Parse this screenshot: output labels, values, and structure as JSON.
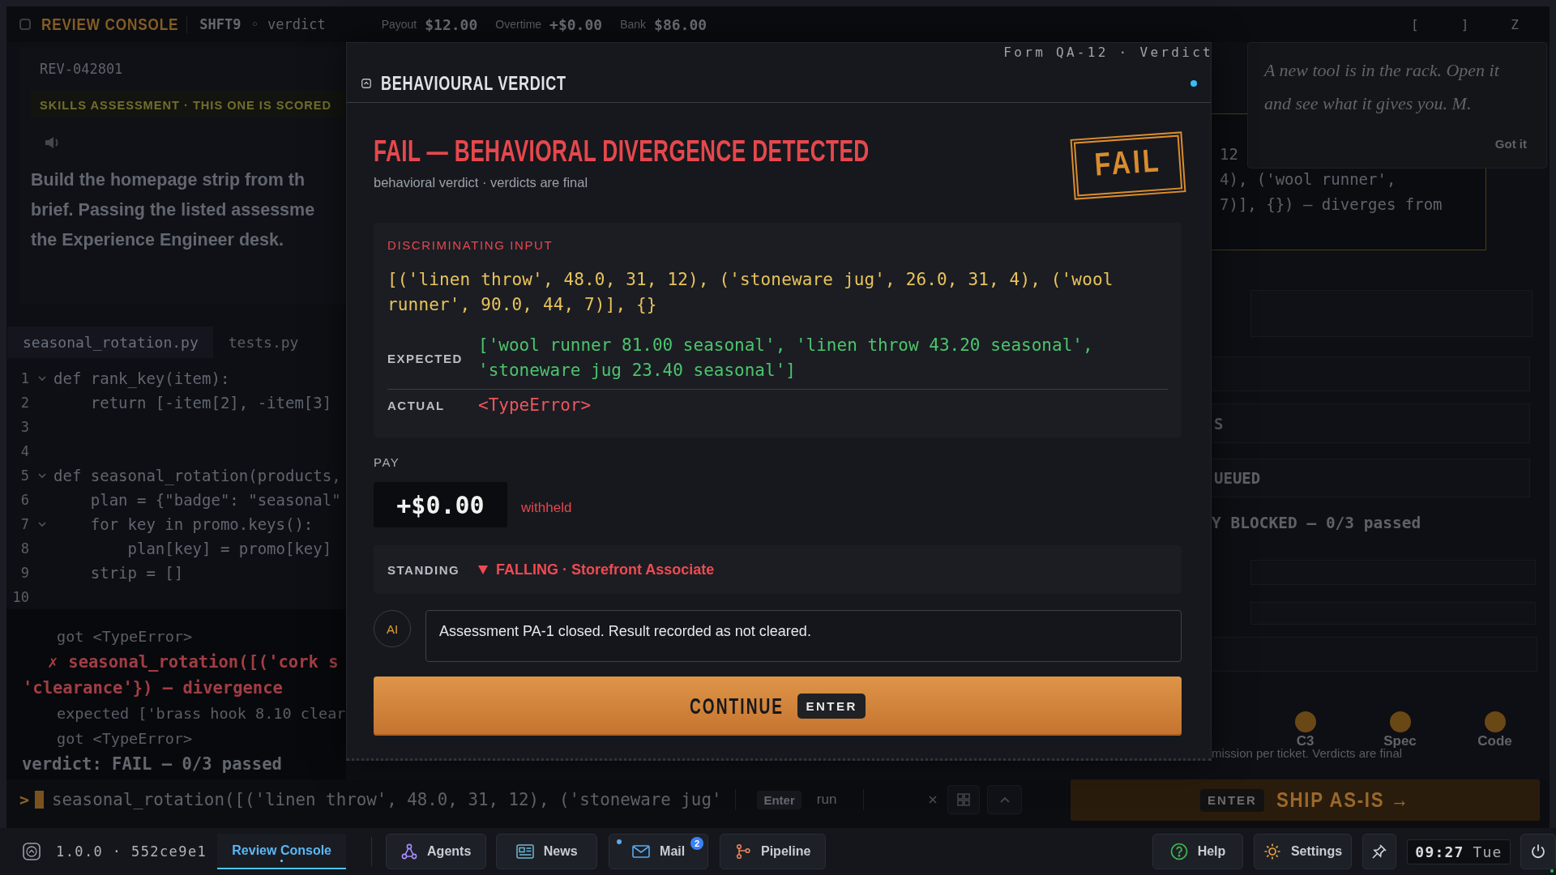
{
  "top_bar": {
    "title": "REVIEW CONSOLE",
    "shift": "SHFT9",
    "stage": "◦ verdict",
    "stats": [
      {
        "label": "Payout",
        "value": "$12.00"
      },
      {
        "label": "Overtime",
        "value": "+$0.00"
      },
      {
        "label": "Bank",
        "value": "$86.00"
      }
    ],
    "keys": [
      "[",
      "]",
      "Z"
    ]
  },
  "brief": {
    "ticket": "REV-042801",
    "banner": "SKILLS ASSESSMENT · THIS ONE IS SCORED",
    "lines": [
      "Build the homepage strip from th",
      "brief. Passing the listed assessme",
      "the Experience Engineer desk."
    ]
  },
  "editor": {
    "tabs": [
      {
        "label": "seasonal_rotation.py",
        "selected": true
      },
      {
        "label": "tests.py",
        "selected": false
      }
    ],
    "lines": [
      {
        "number": "1",
        "fold": true,
        "code": "def rank_key(item):"
      },
      {
        "number": "2",
        "fold": false,
        "code": "    return [-item[2], -item[3]"
      },
      {
        "number": "3",
        "fold": false
      },
      {
        "number": "4",
        "fold": false
      },
      {
        "number": "5",
        "fold": true,
        "code": "def seasonal_rotation(products,"
      },
      {
        "number": "6",
        "fold": false,
        "code": "    plan = {\"badge\": \"seasonal\""
      },
      {
        "number": "7",
        "fold": true,
        "code": "    for key in promo.keys():"
      },
      {
        "number": "8",
        "fold": false,
        "code": "        plan[key] = promo[key]"
      },
      {
        "number": "9",
        "fold": false,
        "code": "    strip = []"
      },
      {
        "number": "10",
        "fold": false
      }
    ]
  },
  "console": {
    "lines": [
      {
        "kind": "output",
        "text": "got <TypeError>"
      },
      {
        "kind": "error",
        "mark": "✗",
        "text": "seasonal_rotation([('cork s"
      },
      {
        "kind": "error",
        "text": "'clearance'}) — divergence"
      },
      {
        "kind": "output",
        "text": "expected ['brass hook 8.10 clear"
      },
      {
        "kind": "output",
        "text": "got <TypeError>"
      },
      {
        "kind": "summary",
        "text": "verdict: FAIL — 0/3 passed"
      }
    ]
  },
  "prompt": {
    "symbol": ">",
    "command": "seasonal_rotation([('linen throw', 48.0, 31, 12), ('stoneware jug'",
    "key": "Enter",
    "action": "run"
  },
  "side": {
    "tip": {
      "text": "A new tool is in the rack. Open it and see what it gives you. M.",
      "button": "Got it"
    },
    "excerpt": [
      "12",
      "4), ('wool runner',",
      "7)], {}) — diverges from"
    ],
    "rows": [
      {
        "kind": "inset"
      },
      {
        "kind": "field"
      },
      {
        "kind": "field",
        "text": "S"
      },
      {
        "kind": "field",
        "text": "UEUED"
      },
      {
        "kind": "status",
        "text": "Y BLOCKED — 0/3 passed"
      },
      {
        "kind": "inset"
      },
      {
        "kind": "inset"
      },
      {
        "kind": "field"
      }
    ],
    "steps": [
      {
        "label": "C3"
      },
      {
        "label": "Spec"
      },
      {
        "label": "Code"
      }
    ],
    "caption": "mission per ticket. Verdicts are final",
    "ship": {
      "key": "ENTER",
      "label": "SHIP AS-IS →"
    }
  },
  "modal": {
    "form_label": "Form QA-12 · Verdict",
    "title": "BEHAVIOURAL VERDICT",
    "verdict": {
      "headline": "FAIL — BEHAVIORAL DIVERGENCE DETECTED",
      "subtitle": "behavioral verdict · verdicts are final",
      "stamp": "FAIL"
    },
    "evidence": {
      "heading": "DISCRIMINATING INPUT",
      "input": "[('linen throw', 48.0, 31, 12), ('stoneware jug', 26.0, 31, 4), ('wool runner', 90.0, 44, 7)], {}",
      "rows": [
        {
          "kind": "expected",
          "label": "EXPECTED",
          "value": "['wool runner 81.00 seasonal', 'linen throw 43.20 seasonal', 'stoneware jug 23.40 seasonal']"
        },
        {
          "kind": "actual",
          "label": "ACTUAL",
          "value": "<TypeError>"
        }
      ]
    },
    "pay": {
      "label": "PAY",
      "amount": "+$0.00",
      "note": "withheld"
    },
    "standing": {
      "label": "STANDING",
      "value": "FALLING · Storefront Associate"
    },
    "message": {
      "avatar": "AI",
      "text": "Assessment PA-1 closed. Result recorded as not cleared."
    },
    "action": {
      "label": "CONTINUE",
      "key": "ENTER"
    }
  },
  "taskbar": {
    "version": "1.0.0 · 552ce9e1",
    "tabs": [
      {
        "label": "Review Console",
        "selected": true
      }
    ],
    "apps": [
      {
        "label": "Agents",
        "unread": false
      },
      {
        "label": "News",
        "unread": false
      },
      {
        "label": "Mail",
        "unread": true,
        "badge": "2"
      },
      {
        "label": "Pipeline",
        "unread": false
      }
    ],
    "tools": [
      {
        "label": "Help"
      },
      {
        "label": "Settings"
      }
    ],
    "clock": {
      "time": "09:27",
      "day": "Tue"
    }
  }
}
